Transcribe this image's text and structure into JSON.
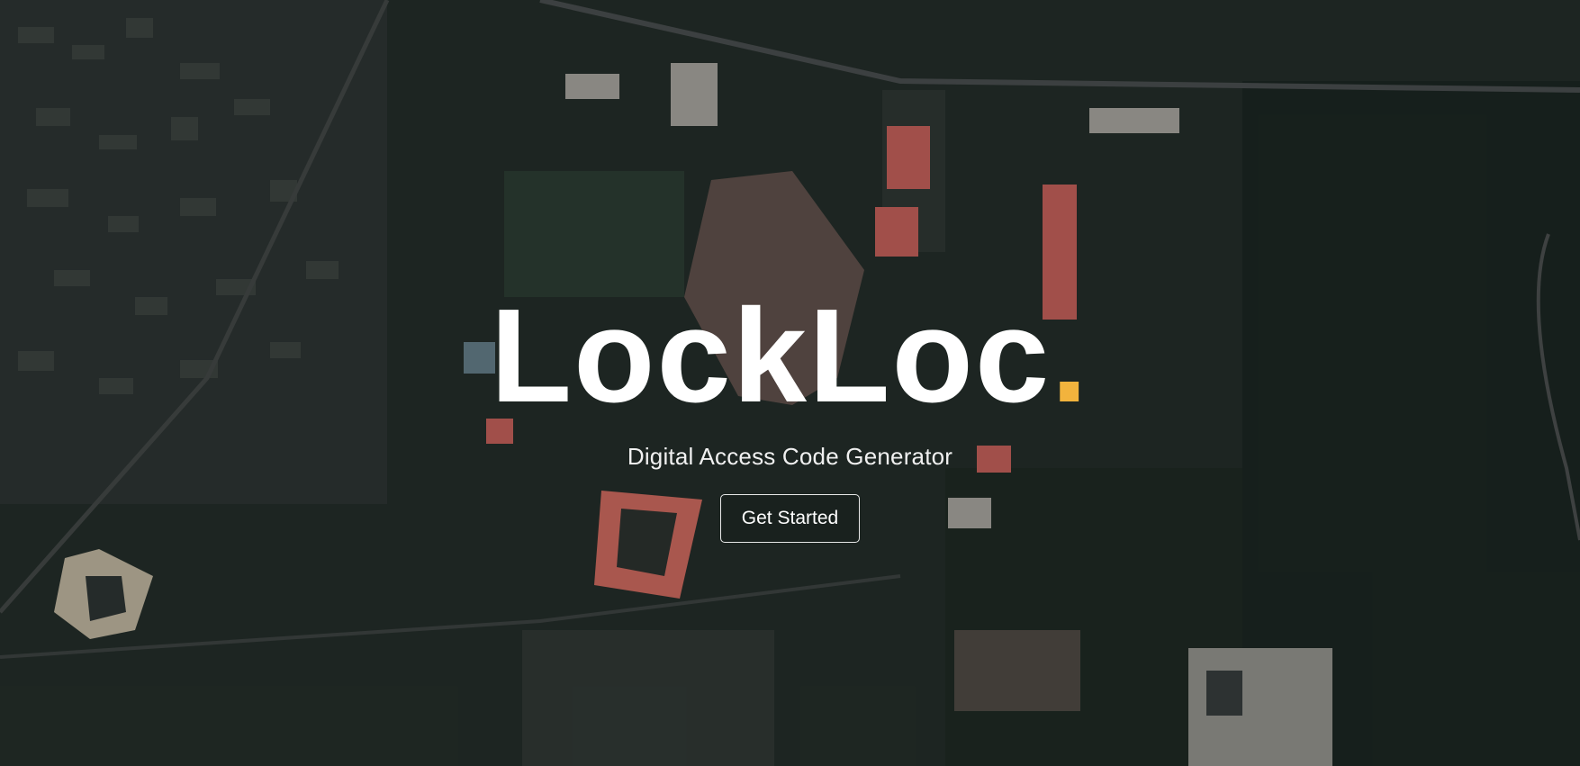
{
  "hero": {
    "title": "LockLoc",
    "title_dot": ".",
    "subtitle": "Digital Access Code Generator",
    "cta_label": "Get Started"
  },
  "colors": {
    "accent": "#f2b33d",
    "text": "#ffffff",
    "background": "#1c2420"
  },
  "background": {
    "type": "aerial-satellite-city-image"
  }
}
